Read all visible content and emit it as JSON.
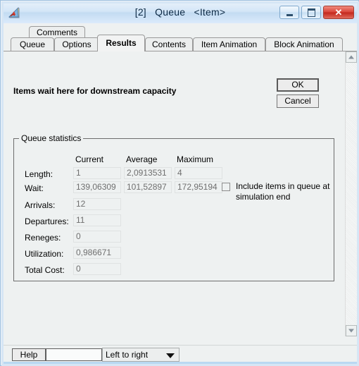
{
  "window": {
    "title": "[2]   Queue   <Item>",
    "icon": "app-icon",
    "caption_buttons": [
      {
        "name": "minimize",
        "glyph": "minimize-icon"
      },
      {
        "name": "maximize",
        "glyph": "maximize-icon"
      },
      {
        "name": "close",
        "glyph": "✕"
      }
    ]
  },
  "tabs": {
    "row1": [
      {
        "label": "Comments",
        "active": false
      }
    ],
    "row2": [
      {
        "label": "Queue",
        "active": false
      },
      {
        "label": "Options",
        "active": false
      },
      {
        "label": "Results",
        "active": true
      },
      {
        "label": "Contents",
        "active": false
      },
      {
        "label": "Item Animation",
        "active": false
      },
      {
        "label": "Block Animation",
        "active": false
      }
    ]
  },
  "page": {
    "description": "Items wait here for downstream capacity",
    "ok_label": "OK",
    "cancel_label": "Cancel"
  },
  "group": {
    "legend": "Queue statistics",
    "column_headers": [
      "Current",
      "Average",
      "Maximum"
    ],
    "rows": [
      {
        "label": "Length:",
        "values": [
          "1",
          "2,0913531",
          "4"
        ]
      },
      {
        "label": "Wait:",
        "values": [
          "139,06309",
          "101,52897",
          "172,95194"
        ]
      },
      {
        "label": "Arrivals:",
        "values": [
          "12"
        ]
      },
      {
        "label": "Departures:",
        "values": [
          "11"
        ]
      },
      {
        "label": "Reneges:",
        "values": [
          "0"
        ]
      },
      {
        "label": "Utilization:",
        "values": [
          "0,986671"
        ]
      },
      {
        "label": "Total Cost:",
        "values": [
          "0"
        ]
      }
    ],
    "checkbox": {
      "label": "Include items in queue at simulation end",
      "checked": false
    }
  },
  "statusbar": {
    "help_label": "Help",
    "status_value": "",
    "direction_selected": "Left to right"
  },
  "scrollbars": {
    "vertical": {
      "up": "scroll-up-icon",
      "down": "scroll-down-icon"
    },
    "horizontal": {
      "left": "scroll-left-icon",
      "right": "scroll-right-icon"
    }
  },
  "colors": {
    "title_bar": "#d4e6f7",
    "client": "#eef1f1",
    "close_button": "#d9453a",
    "field_text": "#6f6f6f"
  }
}
